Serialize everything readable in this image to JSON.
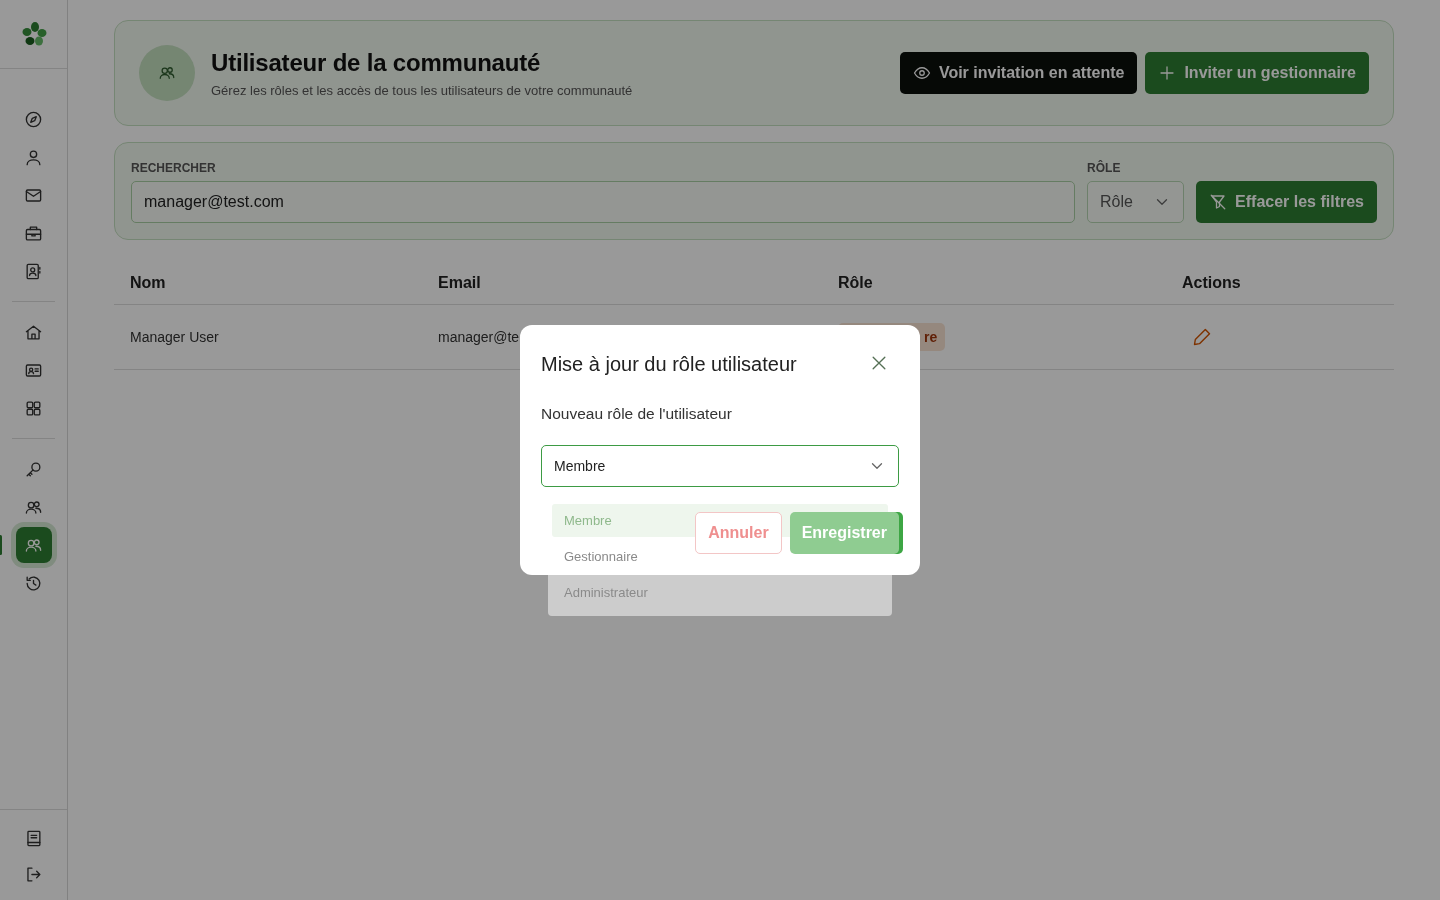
{
  "sidebar": {
    "top": [
      {
        "kind": "compass",
        "selected": false
      },
      {
        "kind": "user",
        "selected": false
      },
      {
        "kind": "mail",
        "selected": false
      },
      {
        "kind": "briefcase",
        "selected": false
      },
      {
        "kind": "contact",
        "selected": false
      }
    ],
    "middle": [
      {
        "kind": "home",
        "selected": false
      },
      {
        "kind": "idcard",
        "selected": false
      },
      {
        "kind": "grid",
        "selected": false
      }
    ],
    "lower": [
      {
        "kind": "key",
        "selected": false
      },
      {
        "kind": "users",
        "selected": false
      },
      {
        "kind": "users",
        "selected": true
      },
      {
        "kind": "history",
        "selected": false
      }
    ],
    "bottom": [
      {
        "kind": "book",
        "selected": false
      },
      {
        "kind": "logout",
        "selected": false
      }
    ]
  },
  "header": {
    "title": "Utilisateur de la communauté",
    "subtitle": "Gérez les rôles et les accès de tous les utilisateurs de votre communauté",
    "buttons": [
      {
        "label": "Voir invitation en attente",
        "kind": "dark"
      },
      {
        "label": "Inviter un gestionnaire",
        "kind": "green"
      }
    ]
  },
  "filters": {
    "search_label": "RECHERCHER",
    "search_value": "manager@test.com",
    "role_label": "RÔLE",
    "role_placeholder": "Rôle",
    "clear_button": "Effacer les filtres"
  },
  "table": {
    "columns": [
      "Nom",
      "Email",
      "Rôle",
      "Actions"
    ],
    "rows": [
      {
        "name": "Manager User",
        "email": "manager@te",
        "role": "re"
      }
    ]
  },
  "modal": {
    "title": "Mise à jour du rôle utilisateur",
    "label": "Nouveau rôle de l'utilisateur",
    "value": "Membre",
    "options": [
      {
        "label": "Membre",
        "selected": true
      },
      {
        "label": "Gestionnaire",
        "selected": false
      },
      {
        "label": "Administrateur",
        "selected": false
      }
    ],
    "cancel": "Annuler",
    "save": "Enregistrer"
  }
}
